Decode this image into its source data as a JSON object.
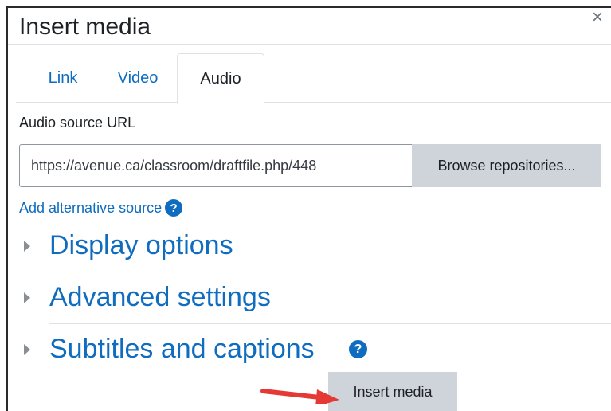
{
  "dialog": {
    "title": "Insert media",
    "close_glyph": "×"
  },
  "tabs": [
    {
      "label": "Link",
      "active": false
    },
    {
      "label": "Video",
      "active": false
    },
    {
      "label": "Audio",
      "active": true
    }
  ],
  "audio": {
    "source_label": "Audio source URL",
    "source_value": "https://avenue.ca/classroom/draftfile.php/448",
    "browse_label": "Browse repositories...",
    "add_alternative_label": "Add alternative source"
  },
  "sections": [
    {
      "title": "Display options",
      "has_help": false
    },
    {
      "title": "Advanced settings",
      "has_help": false
    },
    {
      "title": "Subtitles and captions",
      "has_help": true
    }
  ],
  "footer": {
    "insert_label": "Insert media"
  },
  "icons": {
    "help": "question-circle-icon",
    "caret": "caret-right-icon",
    "close": "close-icon",
    "annotation": "red-arrow-icon"
  },
  "colors": {
    "link": "#0f6cbf",
    "button_bg": "#ced4da",
    "arrow": "#e53935"
  }
}
